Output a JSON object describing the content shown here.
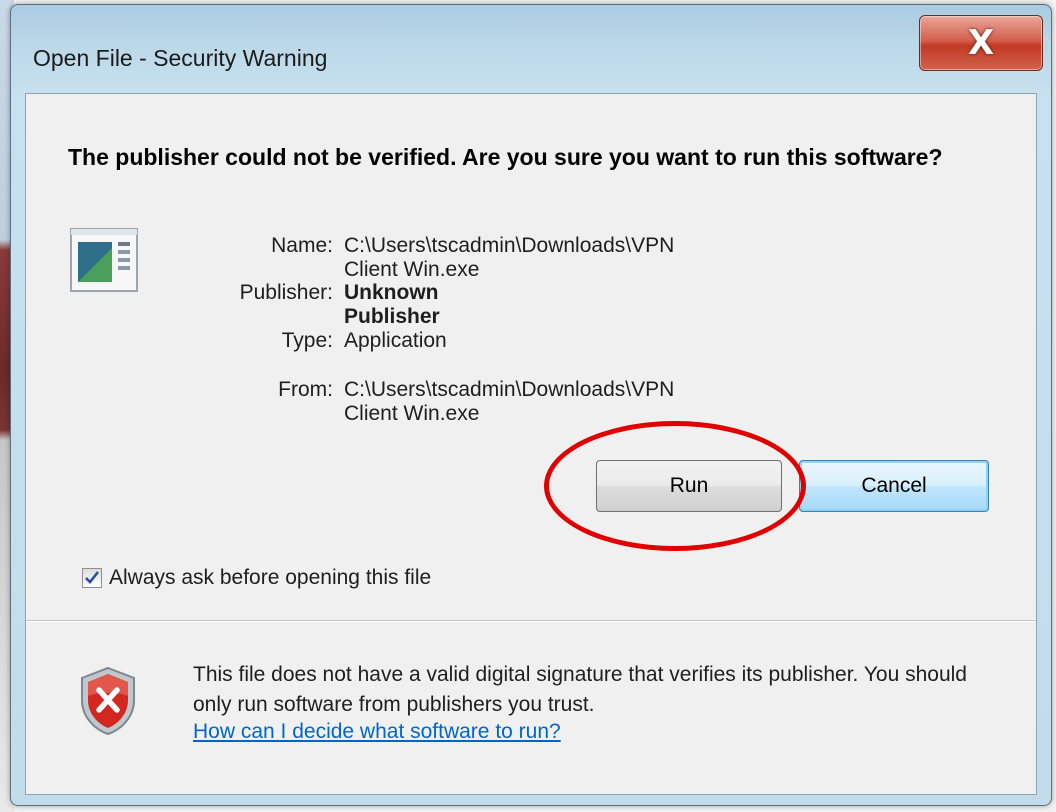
{
  "window": {
    "title": "Open File - Security Warning",
    "close_label": "X"
  },
  "dialog": {
    "heading": "The publisher could not be verified.  Are you sure you want to run this software?",
    "app_icon": "application-icon",
    "properties": [
      {
        "label": "Name:",
        "value": "C:\\Users\\tscadmin\\Downloads\\VPN Client Win.exe"
      },
      {
        "label": "Publisher:",
        "value": "Unknown Publisher"
      },
      {
        "label": "Type:",
        "value": "Application"
      },
      {
        "label": "From:",
        "value": "C:\\Users\\tscadmin\\Downloads\\VPN Client Win.exe"
      }
    ],
    "buttons": {
      "run_label": "Run",
      "cancel_label": "Cancel"
    },
    "checkbox": {
      "label": "Always ask before opening this file",
      "checked": true
    },
    "footer": {
      "warning_icon": "shield-error-icon",
      "message": "This file does not have a valid digital signature that verifies its publisher.  You should only run software from publishers you trust.",
      "help_link": "How can I decide what software to run?"
    }
  },
  "annotation": {
    "shape": "circle",
    "color": "#e00000",
    "highlights": "run-button"
  }
}
